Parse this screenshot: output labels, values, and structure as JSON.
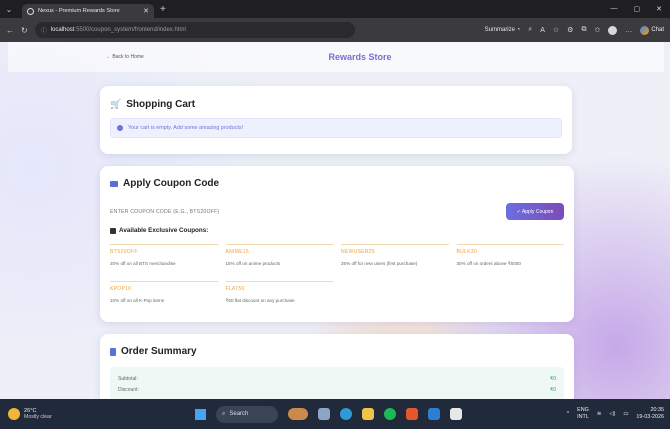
{
  "browser": {
    "tab_title": "Nexus - Premium Rewards Store",
    "url_host": "localhost",
    "url_path": ":5500/coupon_system/frontend/index.html",
    "summarize_label": "Summarize",
    "chat_label": "Chat"
  },
  "page": {
    "back_label": "← Back to Home",
    "store_title": "Rewards Store",
    "cart": {
      "title": "Shopping Cart",
      "empty_message": "Your cart is empty. Add some amazing products!"
    },
    "coupon": {
      "title": "Apply Coupon Code",
      "input_placeholder": "ENTER COUPON CODE (E.G., BTS20OFF)",
      "apply_label": "✓ Apply Coupon",
      "available_title": "Available Exclusive Coupons:",
      "coupons": [
        {
          "code": "BTS20OFF",
          "desc": "20% off on all BTS merchandise"
        },
        {
          "code": "ANIME15",
          "desc": "15% off on anime products"
        },
        {
          "code": "NEWUSER25",
          "desc": "25% off for new users (first purchase)"
        },
        {
          "code": "BULK30",
          "desc": "30% off on orders above ₹5000"
        },
        {
          "code": "KPOP10",
          "desc": "10% off on all K-Pop items"
        },
        {
          "code": "FLAT50",
          "desc": "₹50 flat discount on any purchase"
        }
      ]
    },
    "summary": {
      "title": "Order Summary",
      "rows": [
        {
          "label": "Subtotal:",
          "value": "₹0"
        },
        {
          "label": "Discount:",
          "value": "₹0"
        }
      ]
    }
  },
  "taskbar": {
    "temperature": "26°C",
    "weather": "Mostly clear",
    "search_label": "Search",
    "lang1": "ENG",
    "lang2": "INTL",
    "time": "20:35",
    "date": "19-03-2026"
  }
}
